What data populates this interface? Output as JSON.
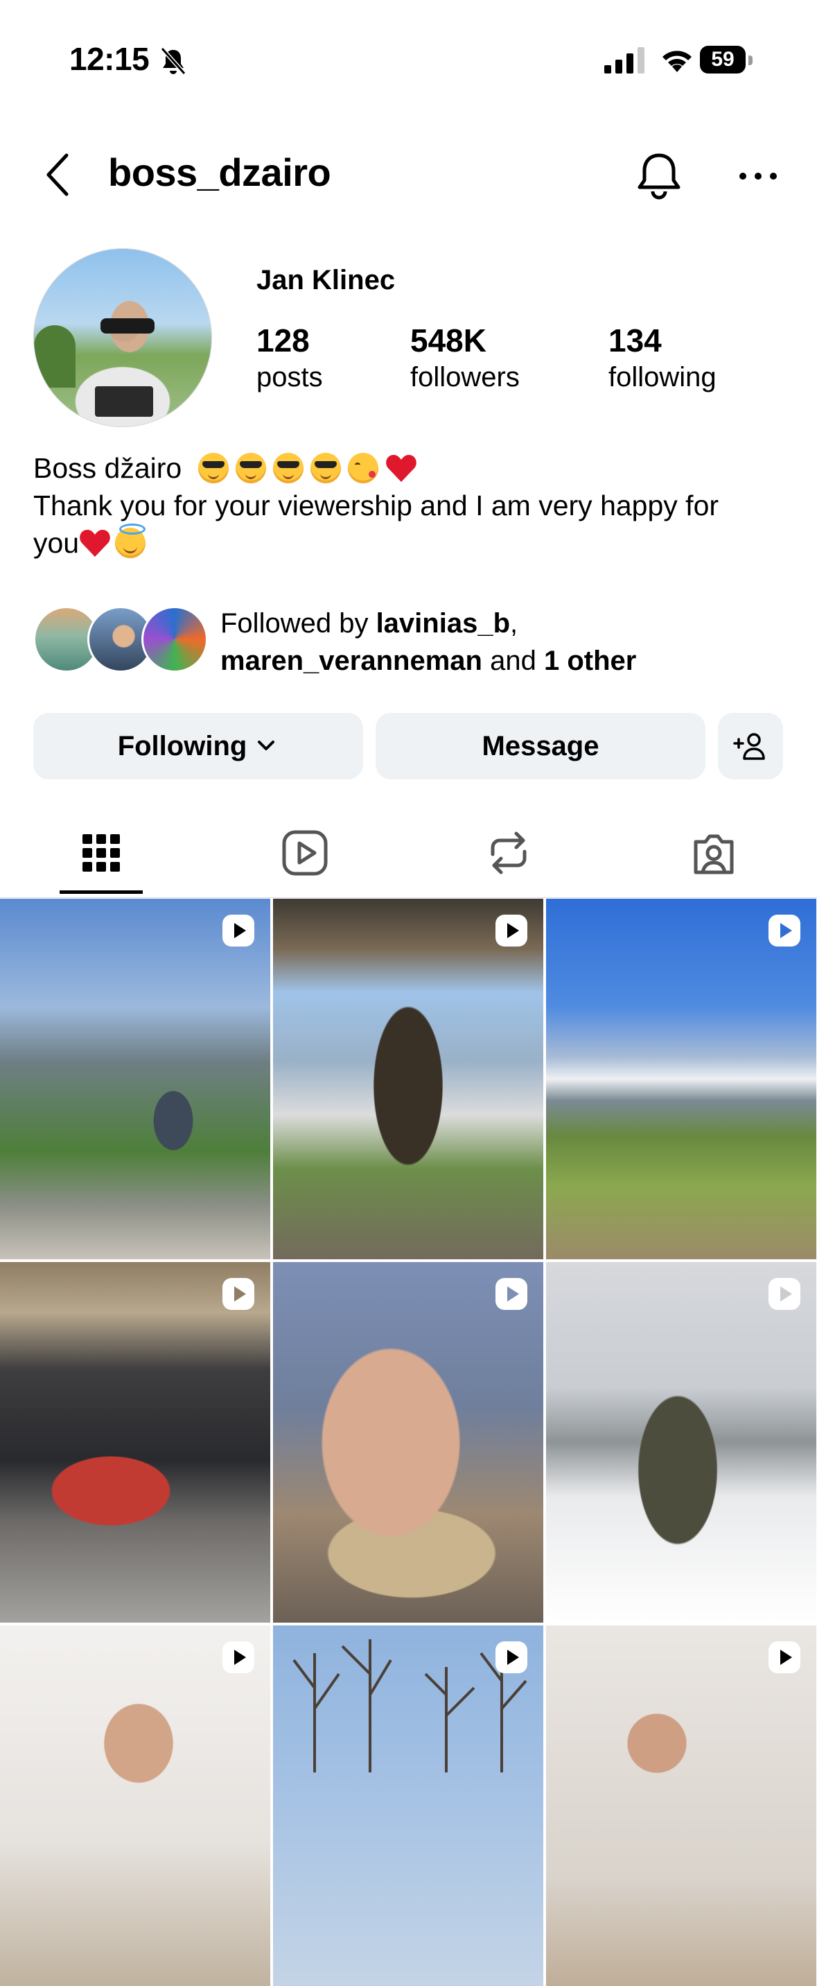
{
  "status_bar": {
    "time": "12:15",
    "battery": "59"
  },
  "header": {
    "username": "boss_dzairo"
  },
  "profile": {
    "full_name": "Jan Klinec",
    "stats": {
      "posts": {
        "value": "128",
        "label": "posts"
      },
      "followers": {
        "value": "548K",
        "label": "followers"
      },
      "following": {
        "value": "134",
        "label": "following"
      }
    },
    "bio": {
      "line1": "Boss džairo",
      "line2": "Thank you for your viewership and I am very happy for",
      "line3": "you"
    },
    "followed_by": {
      "prefix": "Followed by",
      "user1": "lavinias_b",
      "user2": "maren_veranneman",
      "and_text": "and",
      "others": "1 other"
    }
  },
  "actions": {
    "following_label": "Following",
    "message_label": "Message"
  },
  "tabs": [
    "grid",
    "reels",
    "reposts",
    "tagged"
  ],
  "icons": {
    "status": [
      "bell-slash-icon",
      "cellular-signal-icon",
      "wifi-icon",
      "battery-icon"
    ],
    "header": [
      "back-arrow-icon",
      "bell-icon",
      "more-horizontal-icon"
    ],
    "bio_emojis": [
      "sunglasses-face",
      "sunglasses-face",
      "sunglasses-face",
      "sunglasses-face",
      "kissing-face",
      "red-heart",
      "red-heart",
      "halo-face"
    ],
    "tabs": [
      "grid-icon",
      "reels-icon",
      "repost-icon",
      "tagged-person-icon"
    ]
  },
  "colors": {
    "accent_button_bg": "#eff2f5",
    "heart": "#e0182d"
  }
}
